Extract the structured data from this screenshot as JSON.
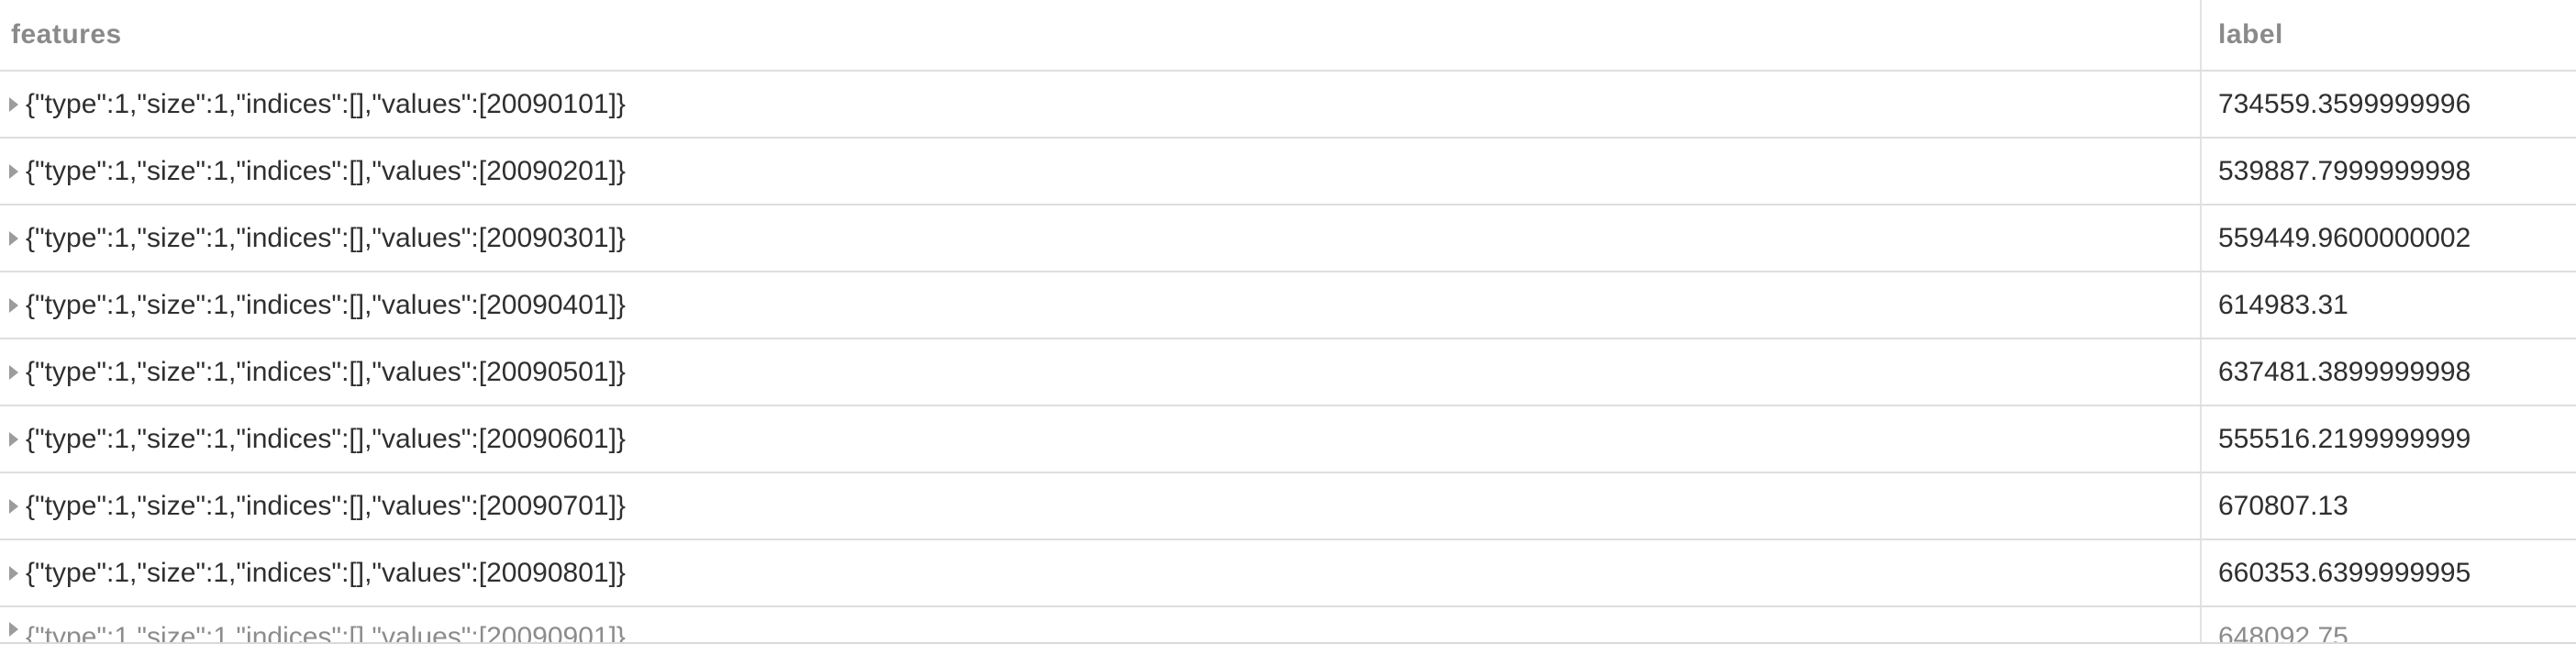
{
  "table": {
    "columns": {
      "features": "features",
      "label": "label"
    },
    "rows": [
      {
        "features": "{\"type\":1,\"size\":1,\"indices\":[],\"values\":[20090101]}",
        "label": "734559.3599999996"
      },
      {
        "features": "{\"type\":1,\"size\":1,\"indices\":[],\"values\":[20090201]}",
        "label": "539887.7999999998"
      },
      {
        "features": "{\"type\":1,\"size\":1,\"indices\":[],\"values\":[20090301]}",
        "label": "559449.9600000002"
      },
      {
        "features": "{\"type\":1,\"size\":1,\"indices\":[],\"values\":[20090401]}",
        "label": "614983.31"
      },
      {
        "features": "{\"type\":1,\"size\":1,\"indices\":[],\"values\":[20090501]}",
        "label": "637481.3899999998"
      },
      {
        "features": "{\"type\":1,\"size\":1,\"indices\":[],\"values\":[20090601]}",
        "label": "555516.2199999999"
      },
      {
        "features": "{\"type\":1,\"size\":1,\"indices\":[],\"values\":[20090701]}",
        "label": "670807.13"
      },
      {
        "features": "{\"type\":1,\"size\":1,\"indices\":[],\"values\":[20090801]}",
        "label": "660353.6399999995"
      },
      {
        "features": "{\"type\":1,\"size\":1,\"indices\":[],\"values\":[20090901]}",
        "label": "648092.75"
      }
    ]
  },
  "icons": {
    "row_expand": "triangle-right-icon"
  }
}
